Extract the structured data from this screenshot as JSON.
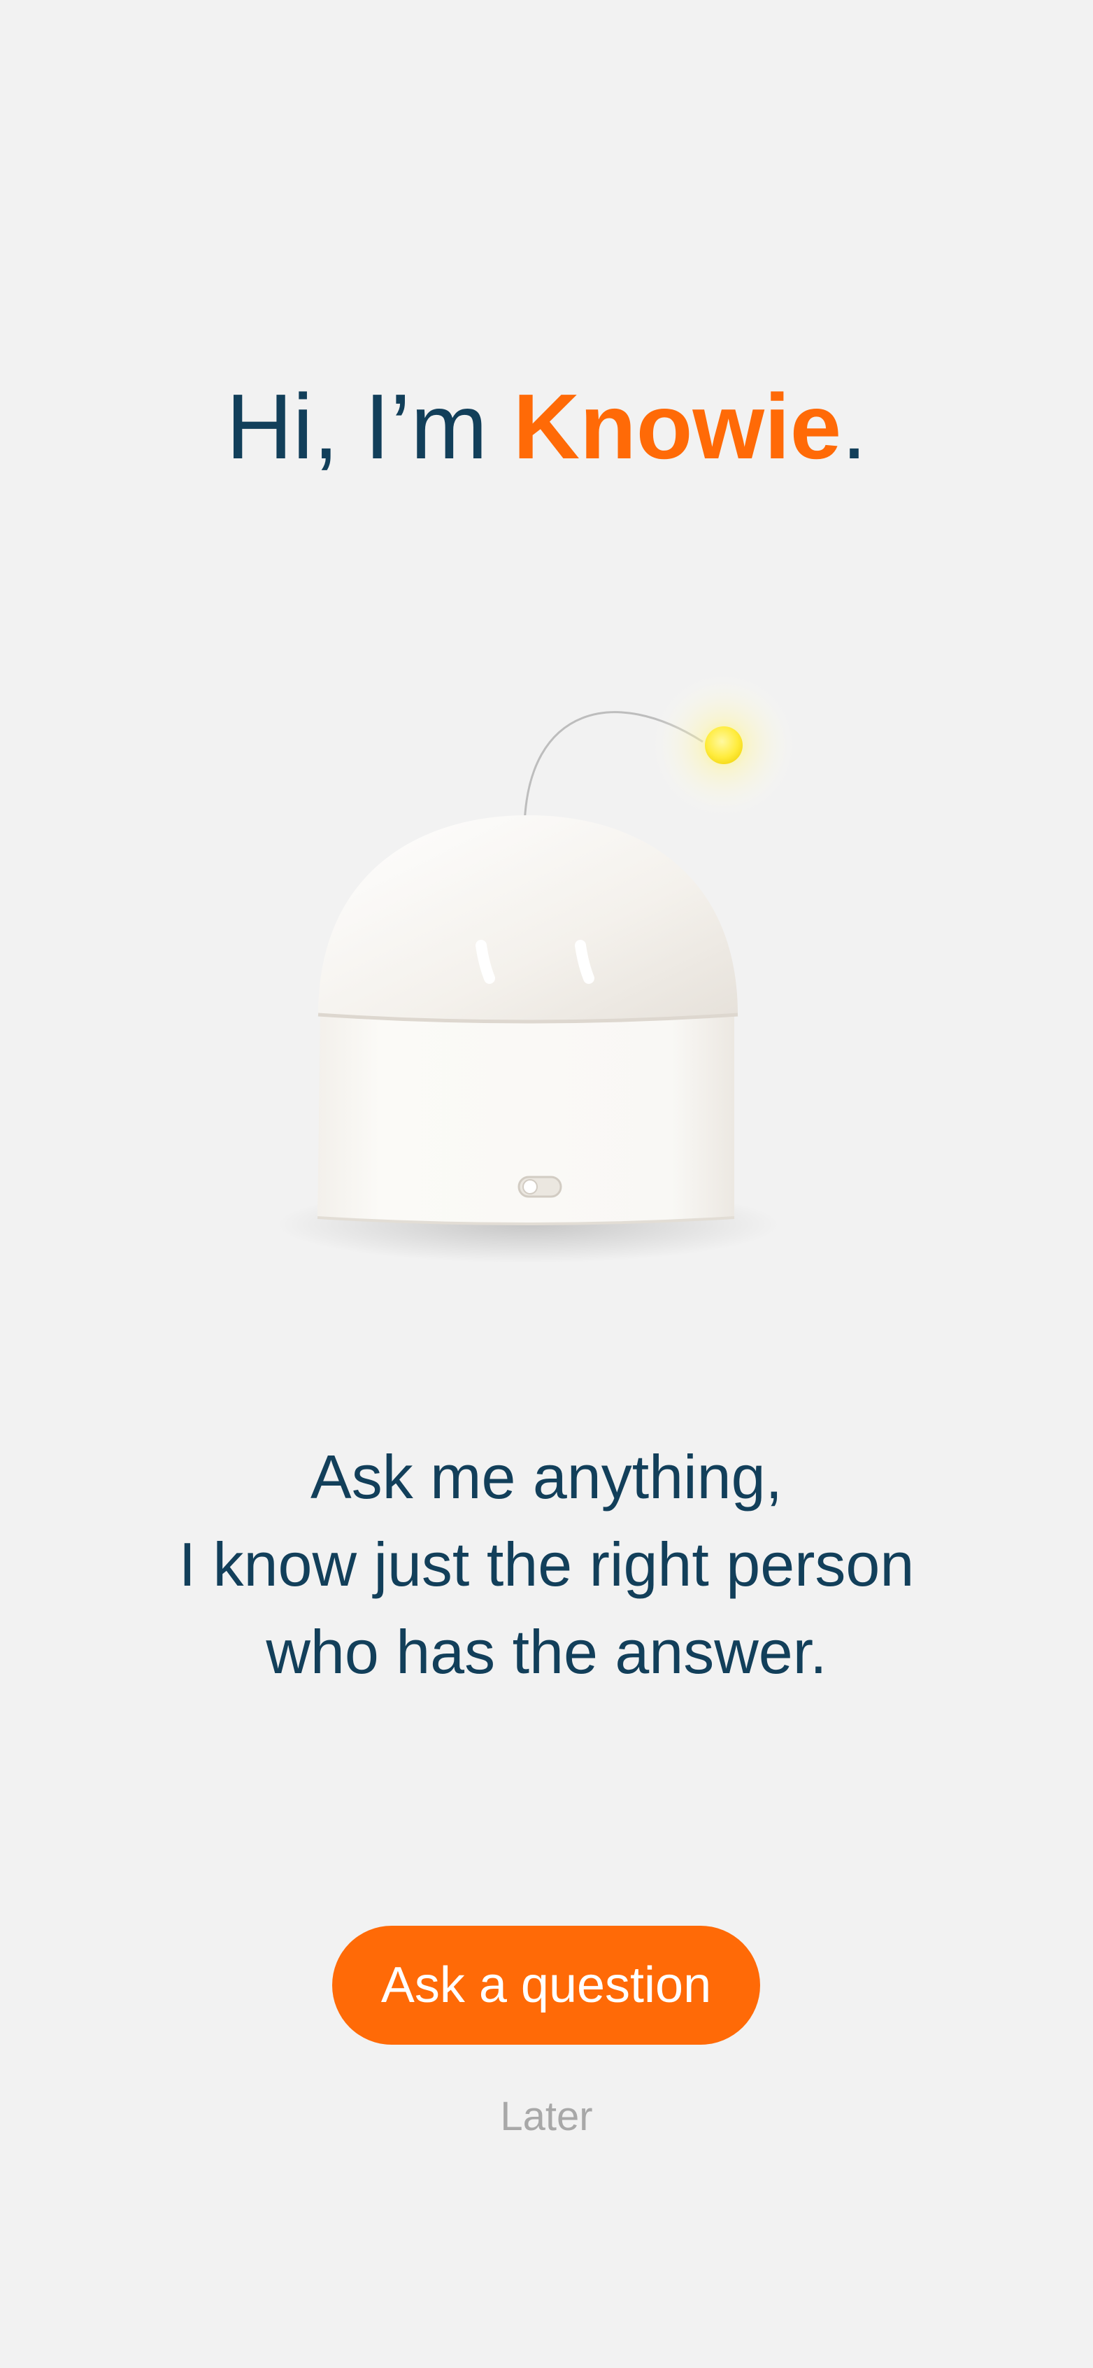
{
  "headline": {
    "prefix": "Hi, I’m ",
    "brand_name": "Knowie",
    "suffix": "."
  },
  "illustration": {
    "icon": "knowie-robot-icon",
    "antenna_light_color": "#ffec3d"
  },
  "tagline": {
    "lines": [
      "Ask me anything,",
      "I know just the right person",
      "who has the answer."
    ]
  },
  "actions": {
    "primary_label": "Ask a question",
    "secondary_label": "Later"
  },
  "colors": {
    "accent": "#ff6a07",
    "text_primary": "#123f5a",
    "text_muted": "#a8a8a8",
    "background": "#f2f2f2"
  }
}
